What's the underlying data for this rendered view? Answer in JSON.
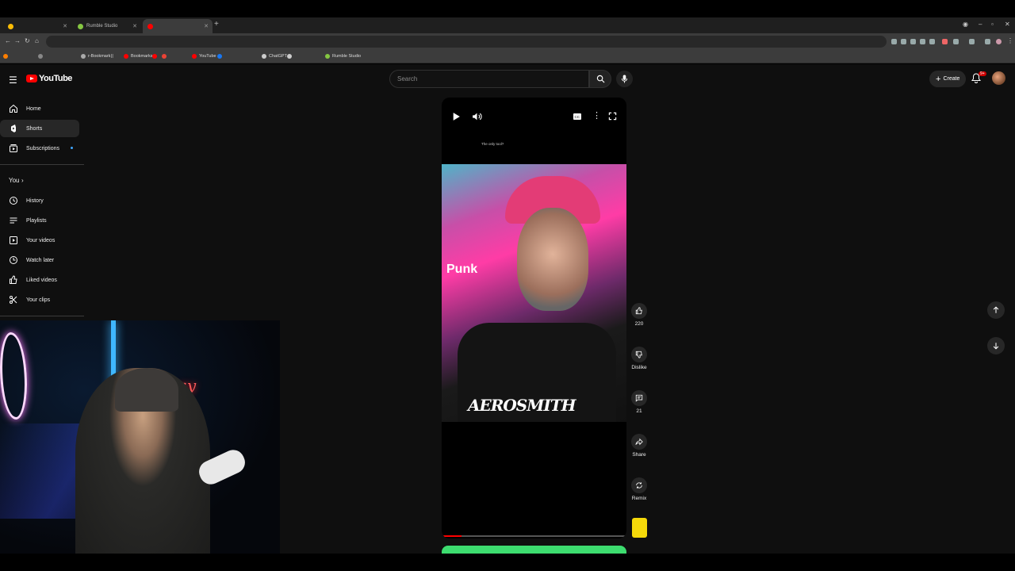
{
  "browser": {
    "tabs": [
      {
        "label": "",
        "active": false,
        "fav_color": "#fbbc05"
      },
      {
        "label": "Rumble Studio",
        "active": false,
        "fav_color": "#85c742"
      },
      {
        "label": "",
        "active": true,
        "fav_color": "#ff0000"
      }
    ],
    "url": "",
    "bookmarks": [
      {
        "label": "",
        "color": "#ff7f00"
      },
      {
        "label": "",
        "color": "#888"
      },
      {
        "label": "r-Bookmark",
        "color": "#aaa"
      },
      {
        "label": "Bookmarks",
        "color": "#ff0000"
      },
      {
        "label": "",
        "color": "#ff0000"
      },
      {
        "label": "",
        "color": "#ea4335"
      },
      {
        "label": "YouTube",
        "color": "#ff0000"
      },
      {
        "label": "",
        "color": "#1877f2"
      },
      {
        "label": "ChatGPT",
        "color": "#cccccc"
      },
      {
        "label": "",
        "color": "#cccccc"
      },
      {
        "label": "Rumble Studio",
        "color": "#85c742"
      }
    ],
    "other_bookmarks": ""
  },
  "header": {
    "logo_text": "YouTube",
    "search_placeholder": "Search",
    "create_label": "Create",
    "bell_badge": "9+"
  },
  "sidebar": {
    "items": [
      {
        "label": "Home",
        "icon": "home-icon",
        "active": false
      },
      {
        "label": "Shorts",
        "icon": "shorts-icon",
        "active": true
      },
      {
        "label": "Subscriptions",
        "icon": "subscriptions-icon",
        "active": false
      }
    ],
    "you_label": "You",
    "you_items": [
      {
        "label": "History",
        "icon": "history-icon"
      },
      {
        "label": "Playlists",
        "icon": "playlists-icon"
      },
      {
        "label": "Your videos",
        "icon": "your-videos-icon"
      },
      {
        "label": "Watch later",
        "icon": "watch-later-icon"
      },
      {
        "label": "Liked videos",
        "icon": "liked-videos-icon"
      },
      {
        "label": "Your clips",
        "icon": "your-clips-icon"
      }
    ]
  },
  "short": {
    "overlay_caption": "The only tool?",
    "punk_label": "Punk",
    "shirt_text": "AEROSMITH",
    "progress": 0.1
  },
  "actions": {
    "like_count": "220",
    "dislike_label": "Dislike",
    "comments_count": "21",
    "share_label": "Share",
    "remix_label": "Remix"
  },
  "colors": {
    "accent": "#ff0000",
    "background": "#0f0f0f",
    "progress_green": "#3ddc6f"
  }
}
